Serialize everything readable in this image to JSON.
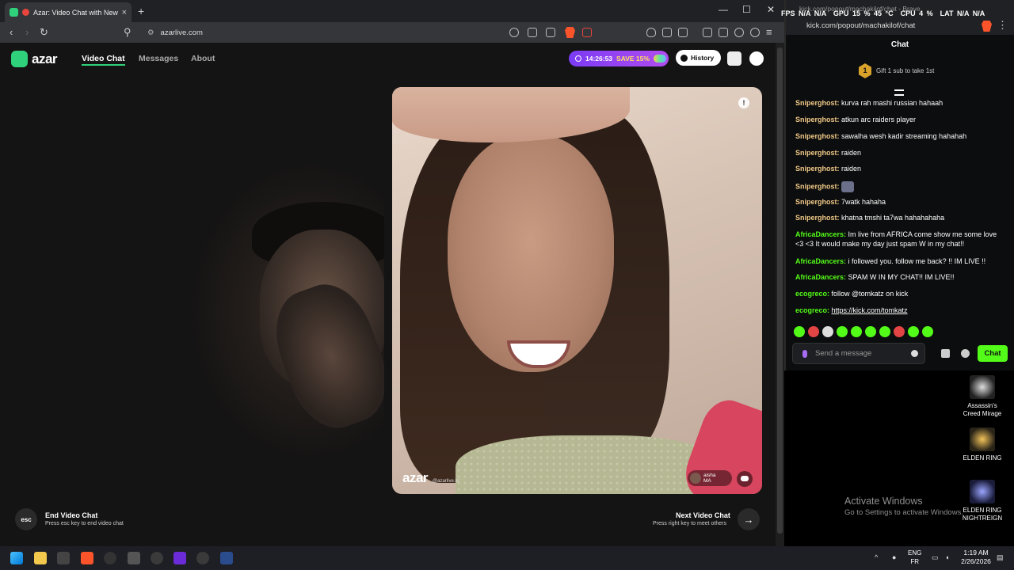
{
  "browser": {
    "tab_title": "Azar: Video Chat with New P...",
    "tab_close": "×",
    "new_tab": "+",
    "url": "azarlive.com",
    "min": "—",
    "max": "☐",
    "close": "✕"
  },
  "site": {
    "logo_text": "azar",
    "nav": [
      "Video Chat",
      "Messages",
      "About"
    ],
    "promo_time": "14:26:53",
    "promo_save": "SAVE 15%",
    "history_label": "History",
    "report_icon": "!",
    "watermark": "azar",
    "watermark_small": "@azarlive.kr",
    "peer_name": "aisha",
    "peer_country": "MA",
    "end_key": "esc",
    "end_title": "End Video Chat",
    "end_sub": "Press esc key to end video chat",
    "next_title": "Next Video Chat",
    "next_sub": "Press right key to meet others",
    "next_icon": "→"
  },
  "overlay": {
    "fps_label": "FPS",
    "fps": "N/A",
    "fps2": "N/A",
    "gpu_label": "GPU",
    "gpu": "15 %",
    "gpu_temp": "45 °C",
    "cpu_label": "CPU",
    "cpu": "4 %",
    "lat_label": "LAT",
    "lat": "N/A",
    "lat2": "N/A"
  },
  "kick": {
    "window_title": "kick.com/popout/machakilof/chat - Brave",
    "url": "kick.com/popout/machakilof/chat",
    "title": "Chat",
    "sub_rank": "1",
    "sub_text": "Gift 1 sub to take 1st",
    "messages": [
      {
        "user": "Sniperghost:",
        "text": "kurva rah mashi russian hahaah",
        "color": "#f0c987"
      },
      {
        "user": "Sniperghost:",
        "text": "atkun arc raiders player",
        "color": "#f0c987"
      },
      {
        "user": "Sniperghost:",
        "text": "sawalha wesh kadir streaming hahahah",
        "color": "#f0c987"
      },
      {
        "user": "Sniperghost:",
        "text": "raiden",
        "color": "#f0c987"
      },
      {
        "user": "Sniperghost:",
        "text": "raiden",
        "color": "#f0c987"
      },
      {
        "user": "Sniperghost:",
        "text": "",
        "color": "#f0c987"
      },
      {
        "user": "Sniperghost:",
        "text": "7watk hahaha",
        "color": "#f0c987"
      },
      {
        "user": "Sniperghost:",
        "text": "khatna tmshi ta7wa hahahahaha",
        "color": "#f0c987"
      },
      {
        "user": "AfricaDancers:",
        "text": "Im live from AFRICA come show me some love <3 <3 It would make my day just spam W in my chat!!",
        "color": "#53fc18"
      },
      {
        "user": "AfricaDancers:",
        "text": "i followed you. follow me back? !! IM LIVE !!",
        "color": "#53fc18"
      },
      {
        "user": "AfricaDancers:",
        "text": "SPAM W IN MY CHAT!! IM LIVE!!",
        "color": "#53fc18"
      },
      {
        "user": "ecogreco:",
        "text": "follow @tomkatz on kick",
        "color": "#53fc18"
      },
      {
        "user": "ecogreco:",
        "text": "https://kick.com/tomkatz",
        "color": "#53fc18"
      }
    ],
    "input_placeholder": "Send a message",
    "chat_button": "Chat"
  },
  "desktop": {
    "icons": [
      {
        "label": "Assassin's Creed Mirage"
      },
      {
        "label": "ELDEN RING"
      },
      {
        "label": "ELDEN RING NIGHTREIGN"
      }
    ],
    "activate_title": "Activate Windows",
    "activate_sub": "Go to Settings to activate Windows."
  },
  "taskbar": {
    "lang1": "ENG",
    "lang2": "FR",
    "time": "1:19 AM",
    "date": "2/26/2026",
    "tray_up": "^"
  },
  "colors": {
    "azar_green": "#2fd17a",
    "kick_green": "#53fc18",
    "promo_purple": "#7b3bf5"
  }
}
